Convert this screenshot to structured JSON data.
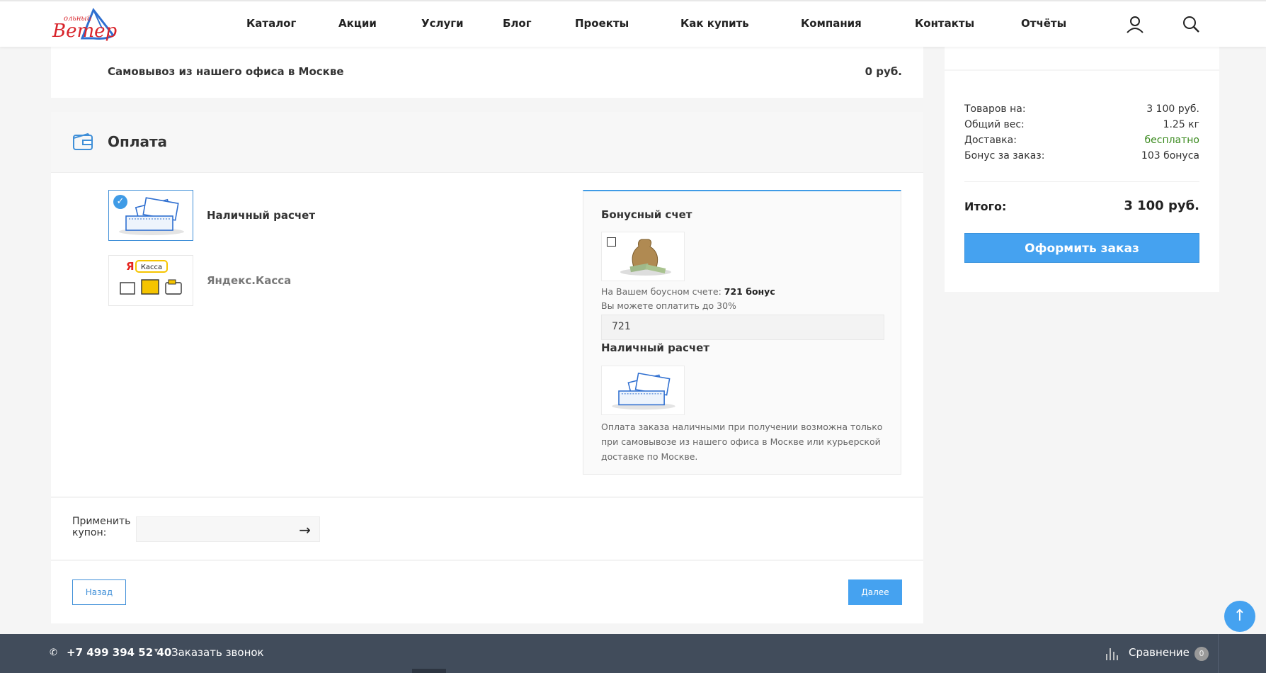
{
  "header": {
    "logo_text": "Вольный Ветер",
    "nav": [
      "Каталог",
      "Акции",
      "Услуги",
      "Блог",
      "Проекты",
      "Как купить",
      "Компания",
      "Контакты",
      "Отчёты"
    ],
    "icons": [
      "user-icon",
      "search-icon"
    ]
  },
  "delivery": {
    "label": "Самовывоз из нашего офиса в Москве",
    "price": "0 руб."
  },
  "payment": {
    "title": "Оплата",
    "methods": [
      {
        "label": "Наличный расчет",
        "selected": true
      },
      {
        "label": "Яндекс.Касса",
        "selected": false,
        "badge": "Касса"
      }
    ],
    "bonus": {
      "title": "Бонусный счет",
      "balance_prefix": "На Вашем боусном счете:",
      "balance_value": "721 бонус",
      "limit_text": "Вы можете оплатить до 30%",
      "input_value": "721"
    },
    "cash": {
      "title": "Наличный расчет",
      "description": "Оплата заказа наличными при получении возможна только при самовывозе из нашего офиса в Москве или курьерской доставке по Москве."
    }
  },
  "coupon": {
    "label": "Применить купон:",
    "value": ""
  },
  "buttons": {
    "back": "Назад",
    "next": "Далее",
    "order": "Оформить заказ"
  },
  "summary": {
    "rows": [
      {
        "label": "Товаров на:",
        "value": "3 100 руб."
      },
      {
        "label": "Общий вес:",
        "value": "1.25 кг"
      },
      {
        "label": "Доставка:",
        "value": "бесплатно"
      },
      {
        "label": "Бонус за заказ:",
        "value": "103 бонуса"
      }
    ],
    "total_label": "Итого:",
    "total_value": "3 100 руб."
  },
  "footer": {
    "phone": "+7 499 394 52 40",
    "callback": "Заказать звонок",
    "compare_label": "Сравнение",
    "compare_count": "0"
  },
  "colors": {
    "accent": "#45a2f0",
    "footer_bg": "#414c5b",
    "free_delivery": "#3a8a1e"
  }
}
